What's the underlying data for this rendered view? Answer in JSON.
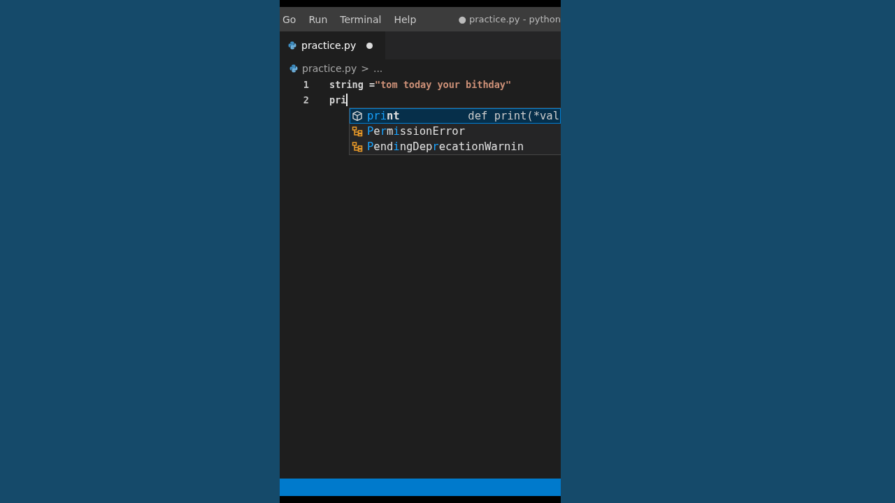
{
  "menu_bar": {
    "items": [
      "Go",
      "Run",
      "Terminal",
      "Help"
    ],
    "title": "● practice.py - python"
  },
  "tabs": [
    {
      "label": "practice.py",
      "selected": true,
      "modified": true
    }
  ],
  "breadcrumb": {
    "file": "practice.py",
    "separator": ">",
    "rest": "..."
  },
  "editor": {
    "lines": [
      {
        "number": "1",
        "tokens": [
          {
            "kind": "variable",
            "text": "string"
          },
          {
            "kind": "operator",
            "text": " ="
          },
          {
            "kind": "string",
            "text": "\"tom today your bithday\""
          }
        ]
      },
      {
        "number": "2",
        "tokens": [
          {
            "kind": "variable",
            "text": "pri"
          }
        ],
        "cursor": true
      }
    ]
  },
  "suggestions": [
    {
      "kind": "method",
      "selected": true,
      "parts": [
        {
          "text": "pri",
          "match": true
        },
        {
          "text": "nt",
          "match": false
        }
      ],
      "detail": "def print(*val"
    },
    {
      "kind": "class",
      "selected": false,
      "parts": [
        {
          "text": "P",
          "match": true
        },
        {
          "text": "e",
          "match": false
        },
        {
          "text": "r",
          "match": true
        },
        {
          "text": "m",
          "match": false
        },
        {
          "text": "i",
          "match": true
        },
        {
          "text": "ssionError",
          "match": false
        }
      ]
    },
    {
      "kind": "class",
      "selected": false,
      "parts": [
        {
          "text": "P",
          "match": true
        },
        {
          "text": "end",
          "match": false
        },
        {
          "text": "i",
          "match": true
        },
        {
          "text": "ngDep",
          "match": false
        },
        {
          "text": "r",
          "match": true
        },
        {
          "text": "ecationWarnin",
          "match": false
        }
      ]
    }
  ]
}
